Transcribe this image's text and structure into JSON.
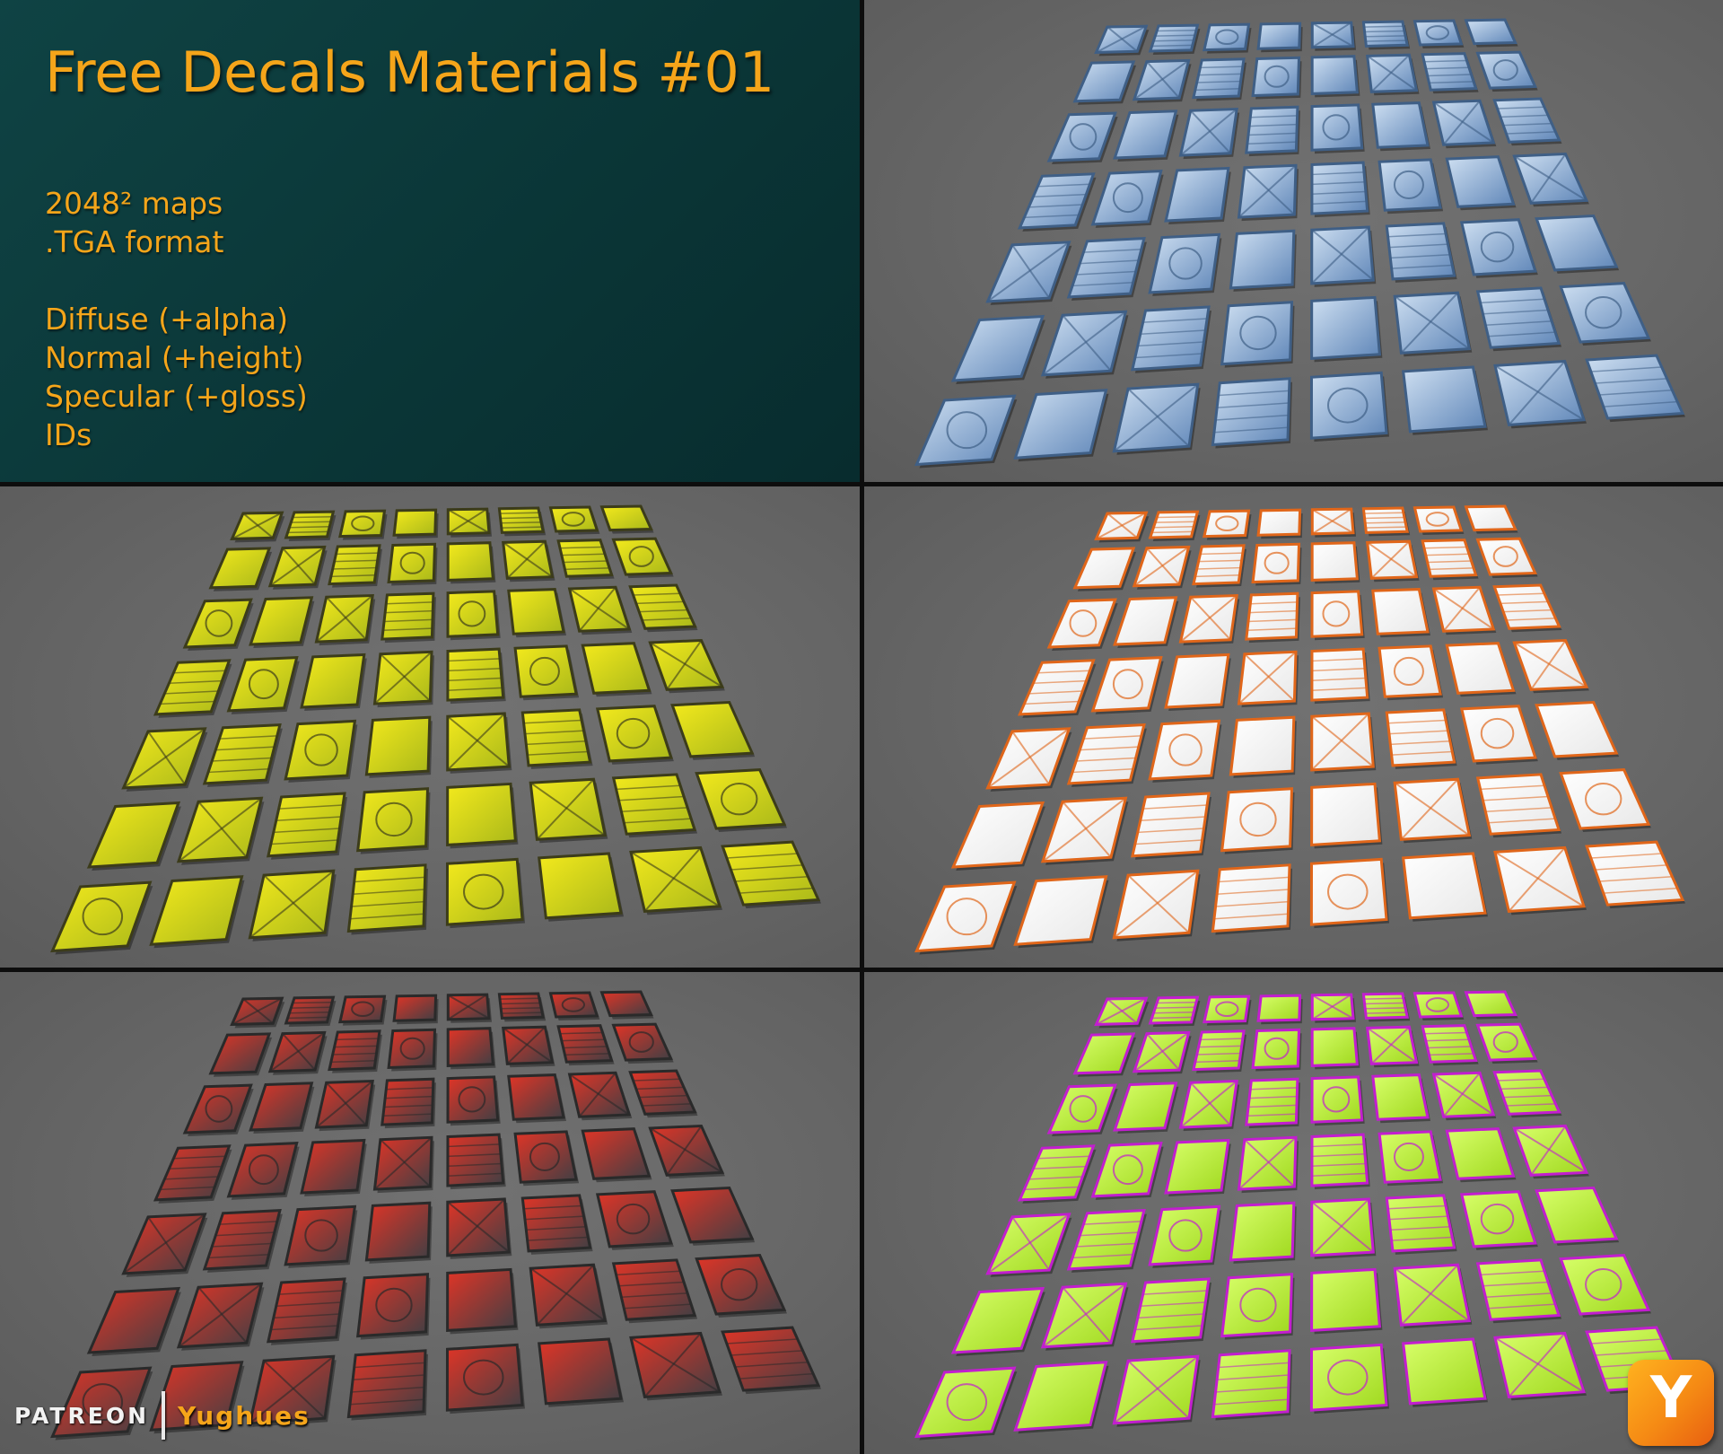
{
  "title": "Free Decals Materials #01",
  "specs": {
    "line1": "2048² maps",
    "line2": ".TGA format",
    "line3": "Diffuse (+alpha)",
    "line4": "Normal (+height)",
    "line5": "Specular (+gloss)",
    "line6": "IDs"
  },
  "branding": {
    "platform": "PATREON",
    "author": "Yughues",
    "logo_letter": "Y"
  },
  "accent_color": "#f5a51a",
  "renders": [
    {
      "id": "blue-metal",
      "base": "#5f86b8",
      "hi": "#cfe0f2",
      "trim": "#3f5f86"
    },
    {
      "id": "yellow",
      "base": "#a9b81a",
      "hi": "#f4ea1c",
      "trim": "#3c3c1a"
    },
    {
      "id": "white-orange",
      "base": "#e8e8e8",
      "hi": "#ffffff",
      "trim": "#e0661a"
    },
    {
      "id": "red-dark",
      "base": "#3f3f44",
      "hi": "#e23426",
      "trim": "#2a2a2a"
    },
    {
      "id": "lime-magenta",
      "base": "#9fd81e",
      "hi": "#d8ff6a",
      "trim": "#c21ecf"
    }
  ]
}
